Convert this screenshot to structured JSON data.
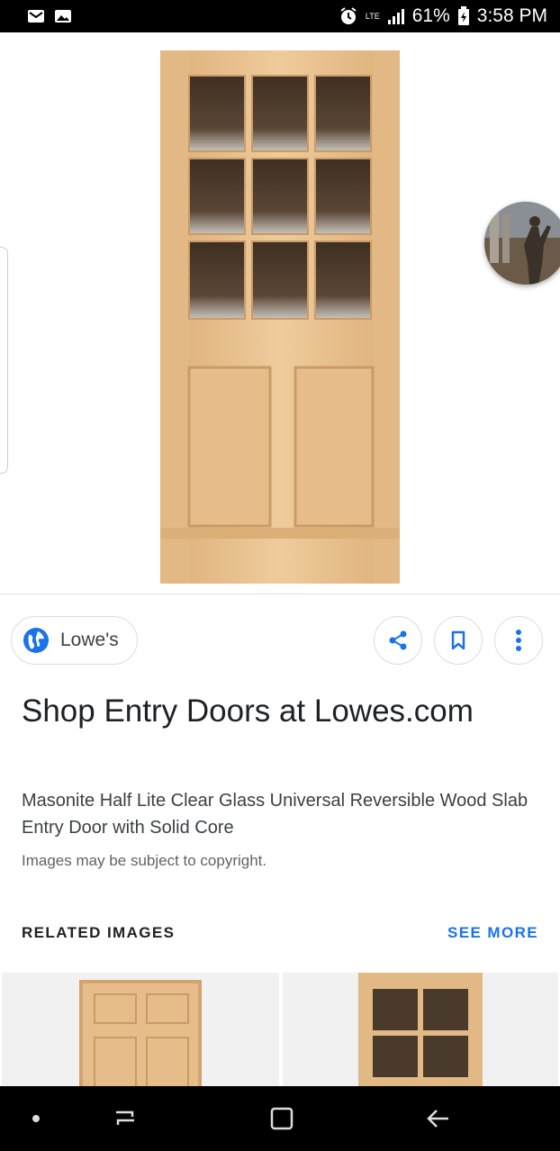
{
  "status_bar": {
    "battery": "61%",
    "time": "3:58 PM",
    "network": "LTE",
    "icons": [
      "gmail-icon",
      "gallery-icon",
      "alarm-icon",
      "signal-icon",
      "battery-icon"
    ]
  },
  "source": {
    "name": "Lowe's",
    "icon": "globe-icon"
  },
  "actions": [
    "share-icon",
    "bookmark-icon",
    "more-vert-icon"
  ],
  "result": {
    "title": "Shop Entry Doors at Lowes.com",
    "description": "Masonite Half Lite Clear Glass Universal Reversible Wood Slab Entry Door with Solid Core",
    "copyright": "Images may be subject to copyright."
  },
  "related": {
    "heading": "RELATED IMAGES",
    "see_more": "SEE MORE"
  },
  "colors": {
    "accent": "#1a73e8",
    "wood": "#e8c08f",
    "glass": "#4a3a2c"
  },
  "nav_bar": [
    "dot-icon",
    "recent-apps-icon",
    "home-icon",
    "back-icon"
  ]
}
